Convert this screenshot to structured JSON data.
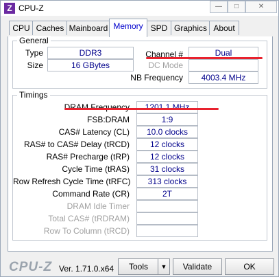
{
  "window": {
    "title": "CPU-Z",
    "icon": "cpuz-app-icon",
    "icon_glyph": "Z",
    "controls": {
      "minimize": "—",
      "maximize": "□",
      "close": "✕"
    }
  },
  "tabs": [
    {
      "label": "CPU",
      "active": false
    },
    {
      "label": "Caches",
      "active": false
    },
    {
      "label": "Mainboard",
      "active": false
    },
    {
      "label": "Memory",
      "active": true
    },
    {
      "label": "SPD",
      "active": false
    },
    {
      "label": "Graphics",
      "active": false
    },
    {
      "label": "About",
      "active": false
    }
  ],
  "general": {
    "title": "General",
    "type_label": "Type",
    "type_value": "DDR3",
    "size_label": "Size",
    "size_value": "16 GBytes",
    "channel_label": "Channel #",
    "channel_value": "Dual",
    "dc_mode_label": "DC Mode",
    "dc_mode_value": "",
    "nb_freq_label": "NB Frequency",
    "nb_freq_value": "4003.4 MHz"
  },
  "timings": {
    "title": "Timings",
    "rows": [
      {
        "label": "DRAM Frequency",
        "value": "1201.1 MHz",
        "enabled": true
      },
      {
        "label": "FSB:DRAM",
        "value": "1:9",
        "enabled": true
      },
      {
        "label": "CAS# Latency (CL)",
        "value": "10.0 clocks",
        "enabled": true
      },
      {
        "label": "RAS# to CAS# Delay (tRCD)",
        "value": "12 clocks",
        "enabled": true
      },
      {
        "label": "RAS# Precharge (tRP)",
        "value": "12 clocks",
        "enabled": true
      },
      {
        "label": "Cycle Time (tRAS)",
        "value": "31 clocks",
        "enabled": true
      },
      {
        "label": "Row Refresh Cycle Time (tRFC)",
        "value": "313 clocks",
        "enabled": true
      },
      {
        "label": "Command Rate (CR)",
        "value": "2T",
        "enabled": true
      },
      {
        "label": "DRAM Idle Timer",
        "value": "",
        "enabled": false
      },
      {
        "label": "Total CAS# (tRDRAM)",
        "value": "",
        "enabled": false
      },
      {
        "label": "Row To Column (tRCD)",
        "value": "",
        "enabled": false
      }
    ]
  },
  "footer": {
    "logo": "CPU-Z",
    "version": "Ver. 1.71.0.x64",
    "tools_label": "Tools",
    "tools_arrow": "▼",
    "validate_label": "Validate",
    "ok_label": "OK"
  },
  "annotation_color": "#e8222e"
}
